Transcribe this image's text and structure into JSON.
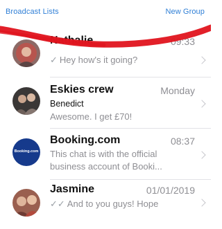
{
  "topbar": {
    "broadcast_label": "Broadcast Lists",
    "new_group_label": "New Group"
  },
  "colors": {
    "accent": "#2f7fd6",
    "annotation": "#e0141e",
    "booking_brand": "#163a8c"
  },
  "chats": [
    {
      "name": "Nathalie",
      "time": "09:33",
      "preview": "Hey how's it going?",
      "status_icon": "single-check-icon"
    },
    {
      "name": "Eskies crew",
      "time": "Monday",
      "sender": "Benedict",
      "preview": "Awesome. I get £70!"
    },
    {
      "name": "Booking.com",
      "time": "08:37",
      "preview_line1": "This chat is with the official",
      "preview_line2": "business account of Booki...",
      "avatar_text": "Booking.com"
    },
    {
      "name": "Jasmine",
      "time": "01/01/2019",
      "preview": "And to you guys!  Hope",
      "status_icon": "double-check-icon"
    }
  ]
}
